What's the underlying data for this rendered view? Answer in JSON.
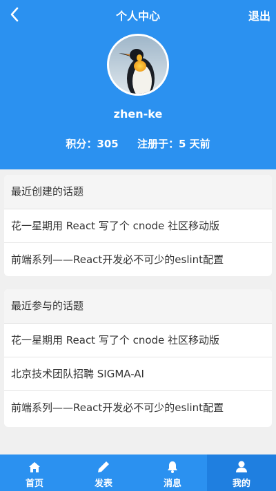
{
  "header": {
    "title": "个人中心",
    "logout_label": "退出",
    "username": "zhen-ke",
    "score_text": "积分：305",
    "registered_text": "注册于：5 天前",
    "color": "#2b91f0"
  },
  "recent_created": {
    "title": "最近创建的话题",
    "topics": [
      "花一星期用 React 写了个 cnode 社区移动版",
      "前端系列——React开发必不可少的eslint配置"
    ]
  },
  "recent_joined": {
    "title": "最近参与的话题",
    "topics": [
      "花一星期用 React 写了个 cnode 社区移动版",
      "北京技术团队招聘 SIGMA-AI",
      "前端系列——React开发必不可少的eslint配置"
    ]
  },
  "tabbar": {
    "items": [
      {
        "label": "首页",
        "icon": "home-icon"
      },
      {
        "label": "发表",
        "icon": "pencil-icon"
      },
      {
        "label": "消息",
        "icon": "bell-icon"
      },
      {
        "label": "我的",
        "icon": "user-icon"
      }
    ],
    "active": "我的"
  }
}
